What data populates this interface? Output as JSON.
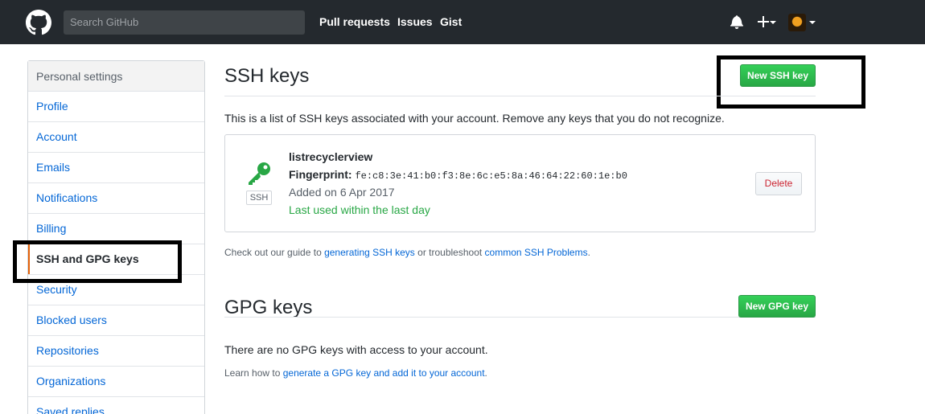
{
  "header": {
    "search_placeholder": "Search GitHub",
    "nav": [
      "Pull requests",
      "Issues",
      "Gist"
    ],
    "icons": [
      "octocat-logo",
      "bell-icon",
      "plus-icon",
      "avatar"
    ]
  },
  "sidebar": {
    "title": "Personal settings",
    "items": [
      {
        "label": "Profile"
      },
      {
        "label": "Account"
      },
      {
        "label": "Emails"
      },
      {
        "label": "Notifications"
      },
      {
        "label": "Billing"
      },
      {
        "label": "SSH and GPG keys",
        "selected": true
      },
      {
        "label": "Security"
      },
      {
        "label": "Blocked users"
      },
      {
        "label": "Repositories"
      },
      {
        "label": "Organizations"
      },
      {
        "label": "Saved replies"
      }
    ]
  },
  "ssh": {
    "title": "SSH keys",
    "new_button": "New SSH key",
    "intro": "This is a list of SSH keys associated with your account. Remove any keys that you do not recognize.",
    "key": {
      "name": "listrecyclerview",
      "fingerprint_label": "Fingerprint:",
      "fingerprint": "fe:c8:3e:41:b0:f3:8e:6c:e5:8a:46:64:22:60:1e:b0",
      "added": "Added on 6 Apr 2017",
      "last_used": "Last used within the last day",
      "tag": "SSH",
      "delete_button": "Delete"
    },
    "guide_prefix": "Check out our guide to ",
    "guide_link1": "generating SSH keys",
    "guide_middle": " or troubleshoot ",
    "guide_link2": "common SSH Problems",
    "guide_suffix": "."
  },
  "gpg": {
    "title": "GPG keys",
    "new_button": "New GPG key",
    "empty": "There are no GPG keys with access to your account.",
    "learn_prefix": "Learn how to ",
    "learn_link": "generate a GPG key and add it to your account",
    "learn_suffix": "."
  },
  "colors": {
    "header_bg": "#24292e",
    "link": "#0366d6",
    "green": "#28a745",
    "danger": "#cb2431",
    "key_icon": "#28a745",
    "highlight": "#000000"
  }
}
